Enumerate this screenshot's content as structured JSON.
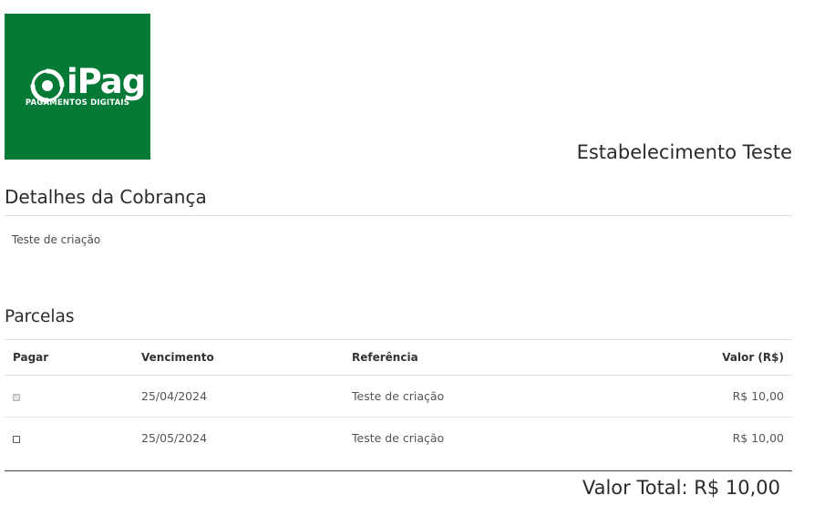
{
  "logo": {
    "name": "iPag",
    "tagline": "PAGAMENTOS DIGITAIS",
    "bg_color": "#057936"
  },
  "merchant_name": "Estabelecimento Teste",
  "details": {
    "title": "Detalhes da Cobrança",
    "description": "Teste de criação"
  },
  "installments": {
    "title": "Parcelas",
    "headers": {
      "pay": "Pagar",
      "due": "Vencimento",
      "ref": "Referência",
      "value": "Valor (R$)"
    },
    "rows": [
      {
        "checked": true,
        "disabled": true,
        "due": "25/04/2024",
        "ref": "Teste de criação",
        "value": "R$ 10,00"
      },
      {
        "checked": false,
        "disabled": false,
        "due": "25/05/2024",
        "ref": "Teste de criação",
        "value": "R$ 10,00"
      }
    ]
  },
  "total": {
    "label": "Valor Total: R$ 10,00"
  }
}
